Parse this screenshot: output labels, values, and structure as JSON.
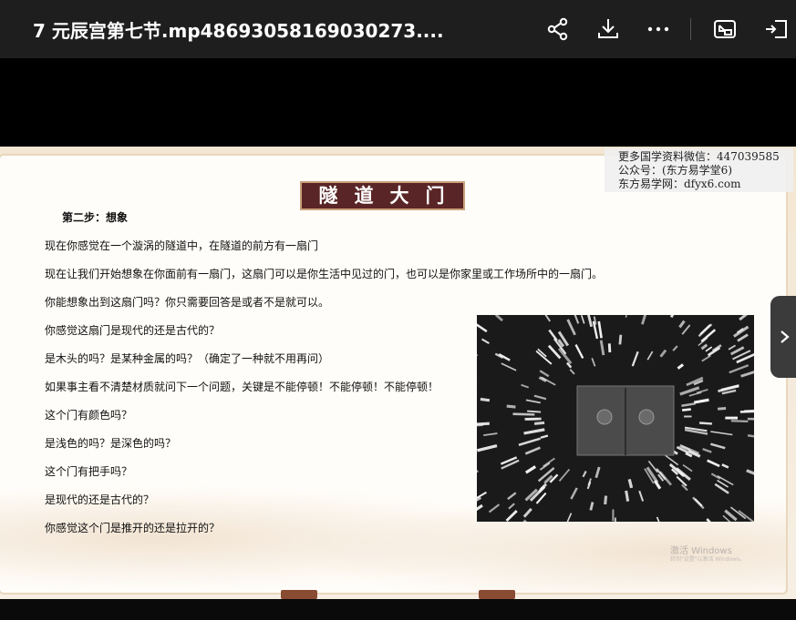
{
  "window": {
    "title": "7 元辰宫第七节.mp48693058169030273....",
    "icons": [
      "share-icon",
      "download-icon",
      "more-icon",
      "picture-in-picture-icon",
      "exit-icon"
    ]
  },
  "slide": {
    "title": "隧道大门",
    "subtitle": "第二步：想象",
    "lines": [
      "现在你感觉在一个漩涡的隧道中，在隧道的前方有一扇门",
      "现在让我们开始想象在你面前有一扇门，这扇门可以是你生活中见过的门，也可以是你家里或工作场所中的一扇门。",
      "你能想象出到这扇门吗？你只需要回答是或者不是就可以。",
      "你感觉这扇门是现代的还是古代的？",
      "是木头的吗？是某种金属的吗？（确定了一种就不用再问）",
      "如果事主看不清楚材质就问下一个问题，关键是不能停顿！不能停顿！不能停顿！",
      "这个门有颜色吗？",
      "是浅色的吗？是深色的吗？",
      "这个门有把手吗？",
      "是现代的还是古代的？",
      "你感觉这个门是推开的还是拉开的？"
    ],
    "watermark": [
      "更多国学资料微信：447039585",
      "公众号：(东方易学堂6)",
      "东方易学网：dfyx6.com"
    ],
    "activate_windows": "激活 Windows",
    "activate_windows_sub": "转到\"设置\"以激活 Windows。"
  },
  "colors": {
    "titlebar_bg": "#1e1e1e",
    "slide_title_bg": "#5a2526",
    "accent_gold": "#caa27a"
  }
}
